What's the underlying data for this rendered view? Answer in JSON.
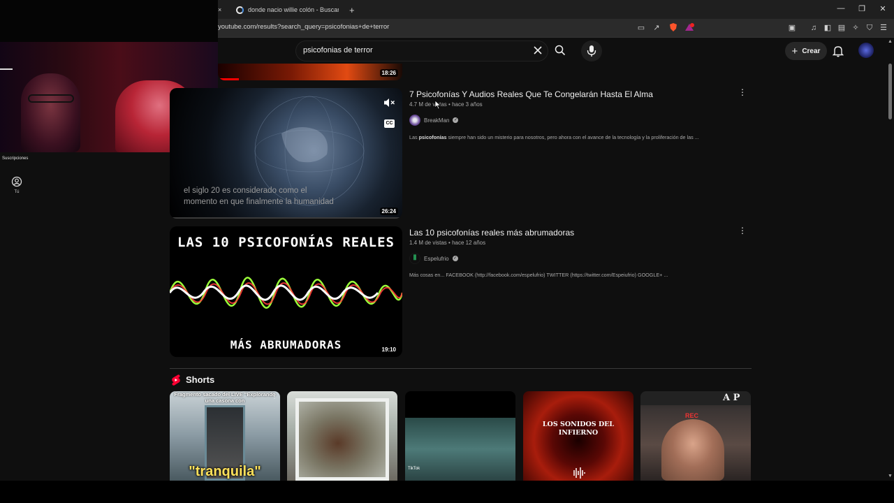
{
  "browser": {
    "tab_active_title": "donde nacio willie colón - Buscar con",
    "tab_close": "×",
    "new_tab": "+",
    "url": "youtube.com/results?search_query=psicofonias+de+terror"
  },
  "header": {
    "search_value": "psicofonias de terror",
    "create_label": "Crear"
  },
  "sidebar": {
    "subscriptions_label": "Suscripciones",
    "you_label": "Tú"
  },
  "videos": [
    {
      "duration": "18:26"
    },
    {
      "title": "7 Psicofonías Y Audios Reales Que Te Congelarán Hasta El Alma",
      "views": "4.7 M de vistas",
      "age": "hace 3 años",
      "channel": "BreakMan",
      "description_pre": "Las ",
      "description_bold": "psicofonías",
      "description_post": " siempre han sido un misterio para nosotros, pero ahora con el avance de la tecnología y la proliferación de las ...",
      "duration": "26:24",
      "caption_line1": "el siglo 20 es considerado como el",
      "caption_line2": "momento en que finalmente la humanidad",
      "cc_label": "CC"
    },
    {
      "title": "Las 10 psicofonías reales más abrumadoras",
      "views": "1.4 M de vistas",
      "age": "hace 12 años",
      "channel": "Espelufrio",
      "description": "Más cosas en... FACEBOOK (http://facebook.com/espelufrio) TWITTER (https://twitter.com/Espeiufrio) GOOGLE+ ...",
      "duration": "19:10",
      "thumb_top_text": "LAS 10 PSICOFONÍAS REALES",
      "thumb_bottom_text": "MÁS ABRUMADORAS"
    }
  ],
  "shorts": {
    "title": "Shorts",
    "items": [
      {
        "top_text": "Fragmento sacado del LIVE \"Explorando una casona con",
        "bottom_text": "\"tranquila\""
      },
      {
        "top_text": ""
      },
      {
        "top_text": "",
        "badge": "TikTok"
      },
      {
        "top_text": "LOS SONIDOS DEL INFIERNO"
      },
      {
        "top_text": "REC",
        "logo": "A P"
      }
    ]
  },
  "colors": {
    "background": "#0f0f0f",
    "shorts_red": "#ff0033",
    "text_secondary": "#aaaaaa"
  }
}
